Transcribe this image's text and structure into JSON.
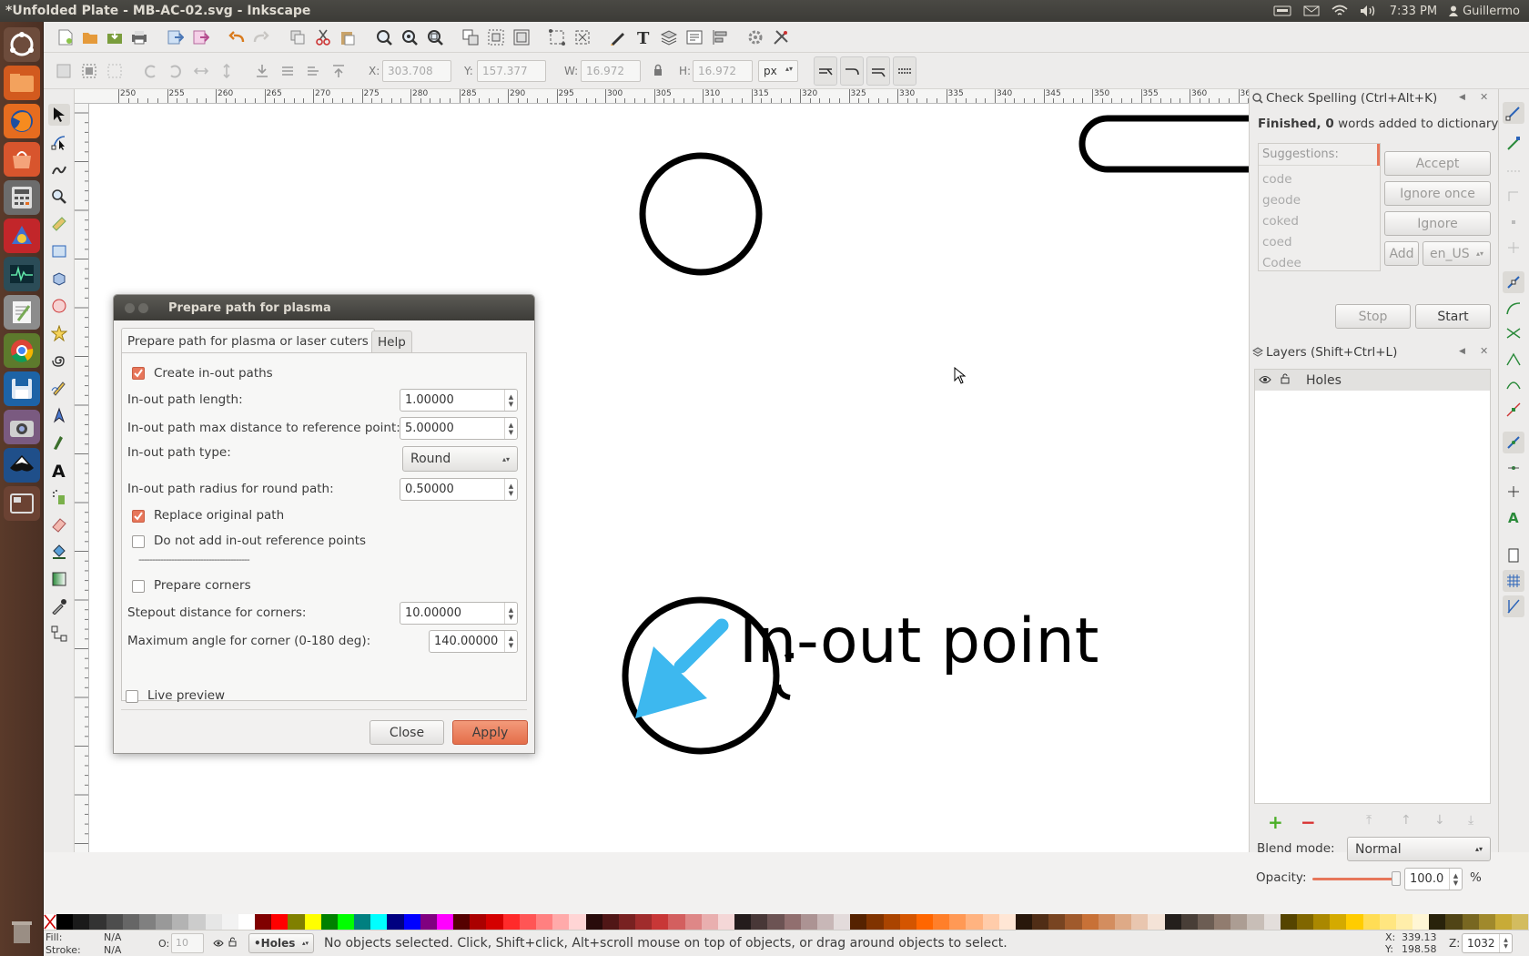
{
  "window": {
    "title": "*Unfolded Plate - MB-AC-02.svg - Inkscape"
  },
  "topbar": {
    "clock": "7:33 PM",
    "user": "Guillermo"
  },
  "launcher": {
    "apps": [
      "ubuntu-dash-icon",
      "files-icon",
      "firefox-icon",
      "software-center-icon",
      "calculator-icon",
      "app-icon",
      "system-monitor-icon",
      "text-editor-icon",
      "chrome-icon",
      "save-icon",
      "camera-icon",
      "inkscape-icon",
      "workspace-icon",
      "trash-icon"
    ]
  },
  "controls": {
    "x_label": "X:",
    "x_value": "303.708",
    "y_label": "Y:",
    "y_value": "157.377",
    "w_label": "W:",
    "w_value": "16.972",
    "h_label": "H:",
    "h_value": "16.972",
    "unit": "px"
  },
  "ruler": {
    "h_ticks": [
      "250",
      "255",
      "260",
      "265",
      "270",
      "275",
      "280",
      "285",
      "290",
      "295",
      "300",
      "305",
      "310",
      "315",
      "320",
      "325",
      "330",
      "335",
      "340",
      "345",
      "350",
      "355",
      "360",
      "365"
    ]
  },
  "canvas": {
    "text": "In-out point",
    "accent": "#3db8ef"
  },
  "dialog": {
    "title": "Prepare path for plasma",
    "tabs": [
      "Prepare path for plasma or laser cuters",
      "Help"
    ],
    "create_inout_label": "Create in-out paths",
    "create_inout_checked": true,
    "length_label": "In-out path length:",
    "length_value": "1.00000",
    "maxdist_label": "In-out path max distance to reference point:",
    "maxdist_value": "5.00000",
    "type_label": "In-out path type:",
    "type_value": "Round",
    "radius_label": "In-out path radius for round path:",
    "radius_value": "0.50000",
    "replace_label": "Replace original path",
    "replace_checked": true,
    "noref_label": "Do not add in-out reference points",
    "noref_checked": false,
    "separator": "-----------------------------------------",
    "corners_label": "Prepare corners",
    "corners_checked": false,
    "stepout_label": "Stepout distance for corners:",
    "stepout_value": "10.00000",
    "maxangle_label": "Maximum angle for corner (0-180 deg):",
    "maxangle_value": "140.00000",
    "live_preview_label": "Live preview",
    "close_label": "Close",
    "apply_label": "Apply"
  },
  "spell": {
    "title": "Check Spelling (Ctrl+Alt+K)",
    "status_bold": "Finished, 0",
    "status_rest": " words added to dictionary",
    "suggestions_header": "Suggestions:",
    "suggestions": [
      "code",
      "geode",
      "coked",
      "coed",
      "Codee"
    ],
    "accept": "Accept",
    "ignore_once": "Ignore once",
    "ignore": "Ignore",
    "add": "Add",
    "lang": "en_US",
    "stop": "Stop",
    "start": "Start"
  },
  "layers": {
    "title": "Layers (Shift+Ctrl+L)",
    "items": [
      "Holes"
    ],
    "blend_label": "Blend mode:",
    "blend_value": "Normal",
    "opacity_label": "Opacity:",
    "opacity_value": "100.0",
    "opacity_unit": "%"
  },
  "status": {
    "fill_label": "Fill:",
    "fill_value": "N/A",
    "stroke_label": "Stroke:",
    "stroke_value": "N/A",
    "o_label": "O:",
    "o_value": "10",
    "layer": "•Holes",
    "message": "No objects selected. Click, Shift+click, Alt+scroll mouse on top of objects, or drag around objects to select.",
    "x_label": "X:",
    "x_coord": "339.13",
    "y_label": "Y:",
    "y_coord": "198.58",
    "z_label": "Z:",
    "zoom": "1032"
  },
  "palette": {
    "colors": [
      "#000000",
      "#1a1a1a",
      "#333333",
      "#4d4d4d",
      "#666666",
      "#808080",
      "#999999",
      "#b3b3b3",
      "#cccccc",
      "#e6e6e6",
      "#f2f2f2",
      "#ffffff",
      "#800000",
      "#ff0000",
      "#808000",
      "#ffff00",
      "#008000",
      "#00ff00",
      "#008080",
      "#00ffff",
      "#000080",
      "#0000ff",
      "#800080",
      "#ff00ff",
      "#550000",
      "#aa0000",
      "#d40000",
      "#ff2a2a",
      "#ff5555",
      "#ff8080",
      "#ffaaaa",
      "#ffd5d5",
      "#280b0b",
      "#501616",
      "#782121",
      "#a02c2c",
      "#c83737",
      "#d35f5f",
      "#de8787",
      "#e9afaf",
      "#f4d7d7",
      "#241c1c",
      "#483737",
      "#6c5353",
      "#916f6f",
      "#ac9393",
      "#c8b7b7",
      "#e3dbdb",
      "#552200",
      "#803300",
      "#aa4400",
      "#d45500",
      "#ff6600",
      "#ff7f2a",
      "#ff9955",
      "#ffb380",
      "#ffccaa",
      "#ffe6d5",
      "#28170b",
      "#502d16",
      "#784421",
      "#a05a2c",
      "#c87137",
      "#d38d5f",
      "#deaa87",
      "#e9c6af",
      "#f4e3d7",
      "#241f1c",
      "#483e37",
      "#6c5d53",
      "#917c6f",
      "#ac9d93",
      "#c8beb7",
      "#e3dedb",
      "#554400",
      "#806600",
      "#aa8800",
      "#d4aa00",
      "#ffcc00",
      "#ffdd55",
      "#ffe680",
      "#ffeeaa",
      "#fff6d5",
      "#28220b",
      "#504416",
      "#786721",
      "#a0892c",
      "#c8ab37",
      "#d3bc5f"
    ]
  }
}
